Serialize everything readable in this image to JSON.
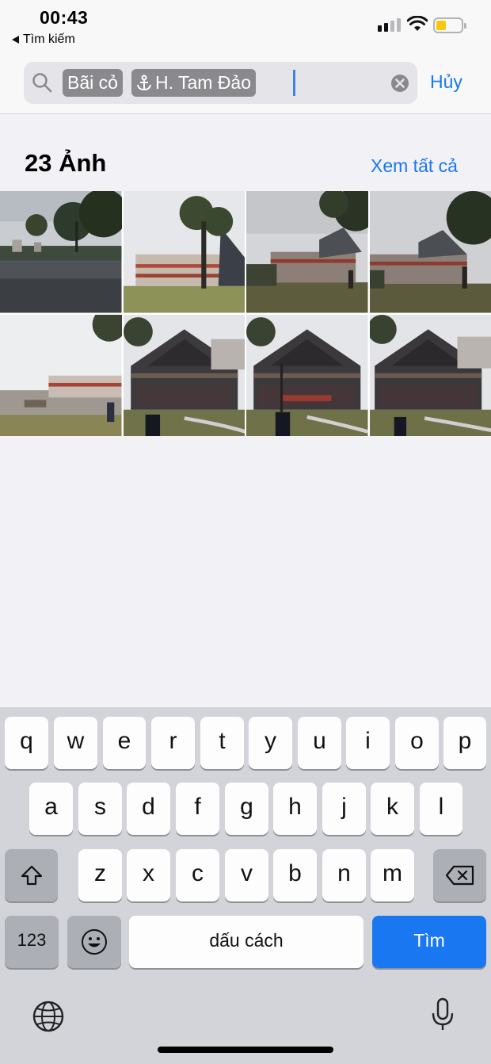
{
  "status_bar": {
    "time": "00:43",
    "back_label": "Tìm kiếm",
    "signal_bars": 4,
    "signal_active": 2,
    "battery_level": 0.3,
    "battery_color": "#f6c90e"
  },
  "search": {
    "tokens": [
      {
        "label": "Bãi cỏ",
        "icon": "none"
      },
      {
        "label": "H. Tam Đảo",
        "icon": "location-pin-icon"
      }
    ],
    "cancel_label": "Hủy"
  },
  "results": {
    "title": "23 Ảnh",
    "see_all_label": "Xem tất cả",
    "thumbnails": [
      {
        "name": "lake-trees"
      },
      {
        "name": "pine-hotel"
      },
      {
        "name": "cloudy-hotel"
      },
      {
        "name": "cloudy-hotel-2"
      },
      {
        "name": "lawn-buildings"
      },
      {
        "name": "wooden-house"
      },
      {
        "name": "wooden-house-2"
      },
      {
        "name": "wooden-house-3"
      }
    ]
  },
  "keyboard": {
    "row1": [
      "q",
      "w",
      "e",
      "r",
      "t",
      "y",
      "u",
      "i",
      "o",
      "p"
    ],
    "row2": [
      "a",
      "s",
      "d",
      "f",
      "g",
      "h",
      "j",
      "k",
      "l"
    ],
    "row3": [
      "z",
      "x",
      "c",
      "v",
      "b",
      "n",
      "m"
    ],
    "numbers_label": "123",
    "space_label": "dấu cách",
    "search_label": "Tìm",
    "accent": "#1a77f2"
  }
}
